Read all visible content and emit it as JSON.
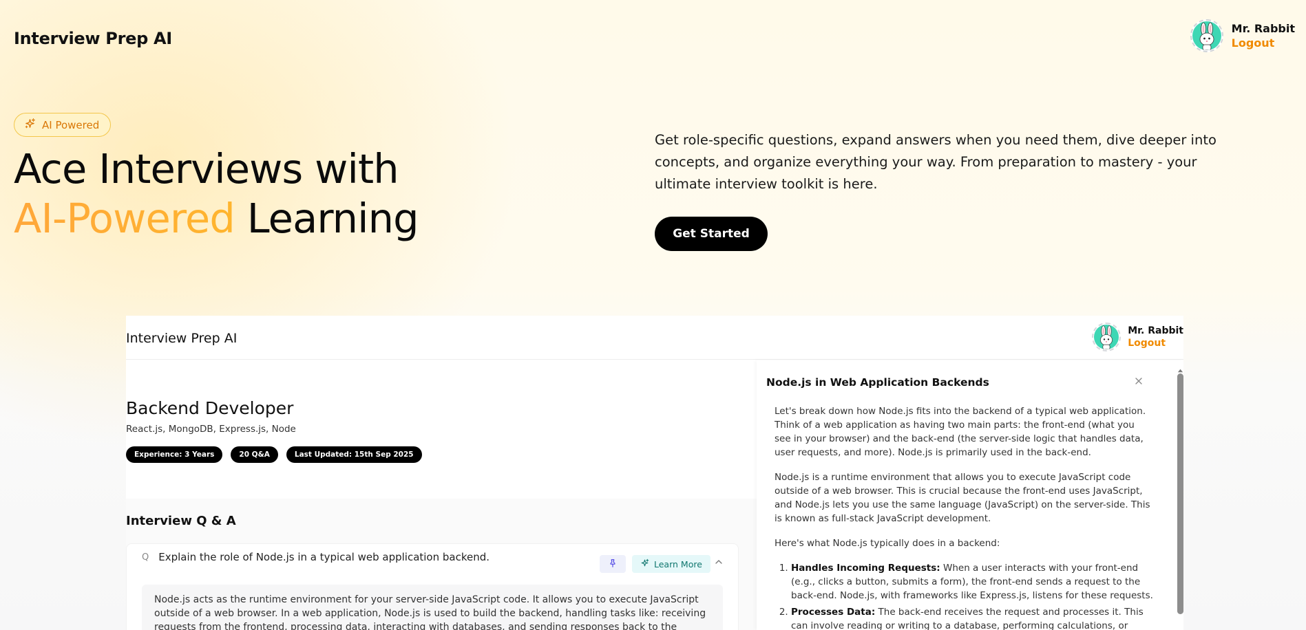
{
  "header": {
    "brand": "Interview Prep AI",
    "user_name": "Mr. Rabbit",
    "logout_label": "Logout"
  },
  "hero": {
    "badge_label": "AI Powered",
    "title_line1": "Ace Interviews with",
    "title_accent": "AI-Powered",
    "title_rest": " Learning",
    "description": "Get role-specific questions, expand answers when you need them, dive deeper into concepts, and organize everything your way. From preparation to mastery - your ultimate interview toolkit is here.",
    "cta_label": "Get Started"
  },
  "preview": {
    "brand": "Interview Prep AI",
    "user_name": "Mr. Rabbit",
    "logout_label": "Logout",
    "role_title": "Backend Developer",
    "topics": "React.js, MongoDB, Express.js, Node",
    "pills": [
      "Experience: 3 Years",
      "20 Q&A",
      "Last Updated: 15th Sep 2025"
    ],
    "qa_title": "Interview Q & A",
    "question": {
      "marker": "Q",
      "text": "Explain the role of Node.js in a typical web application backend.",
      "learn_more_label": "Learn More",
      "answer": "Node.js acts as the runtime environment for your server-side JavaScript code. It allows you to execute JavaScript outside of a web browser. In a web application, Node.js is used to build the backend, handling tasks like: receiving requests from the frontend, processing data, interacting with databases, and sending responses back to the frontend. It enables building scalable and fast"
    },
    "drawer": {
      "title": "Node.js in Web Application Backends",
      "paragraphs": [
        "Let's break down how Node.js fits into the backend of a typical web application. Think of a web application as having two main parts: the front-end (what you see in your browser) and the back-end (the server-side logic that handles data, user requests, and more). Node.js is primarily used in the back-end.",
        "Node.js is a runtime environment that allows you to execute JavaScript code outside of a web browser. This is crucial because the front-end uses JavaScript, and Node.js lets you use the same language (JavaScript) on the server-side. This is known as full-stack JavaScript development.",
        "Here's what Node.js typically does in a backend:"
      ],
      "list": [
        {
          "bold": "Handles Incoming Requests:",
          "text": " When a user interacts with your front-end (e.g., clicks a button, submits a form), the front-end sends a request to the back-end. Node.js, with frameworks like Express.js, listens for these requests."
        },
        {
          "bold": "Processes Data:",
          "text": " The back-end receives the request and processes it. This can involve reading or writing to a database, performing calculations, or calling other"
        }
      ]
    }
  },
  "colors": {
    "accent_orange": "#f08a00",
    "badge_bg": "#fff3c8",
    "avatar_bg": "#3ed7b4"
  },
  "icons": [
    "sparkle-icon",
    "rabbit-avatar",
    "pin-icon",
    "chevron-up-icon",
    "close-icon",
    "scroll-up-arrow-icon"
  ]
}
